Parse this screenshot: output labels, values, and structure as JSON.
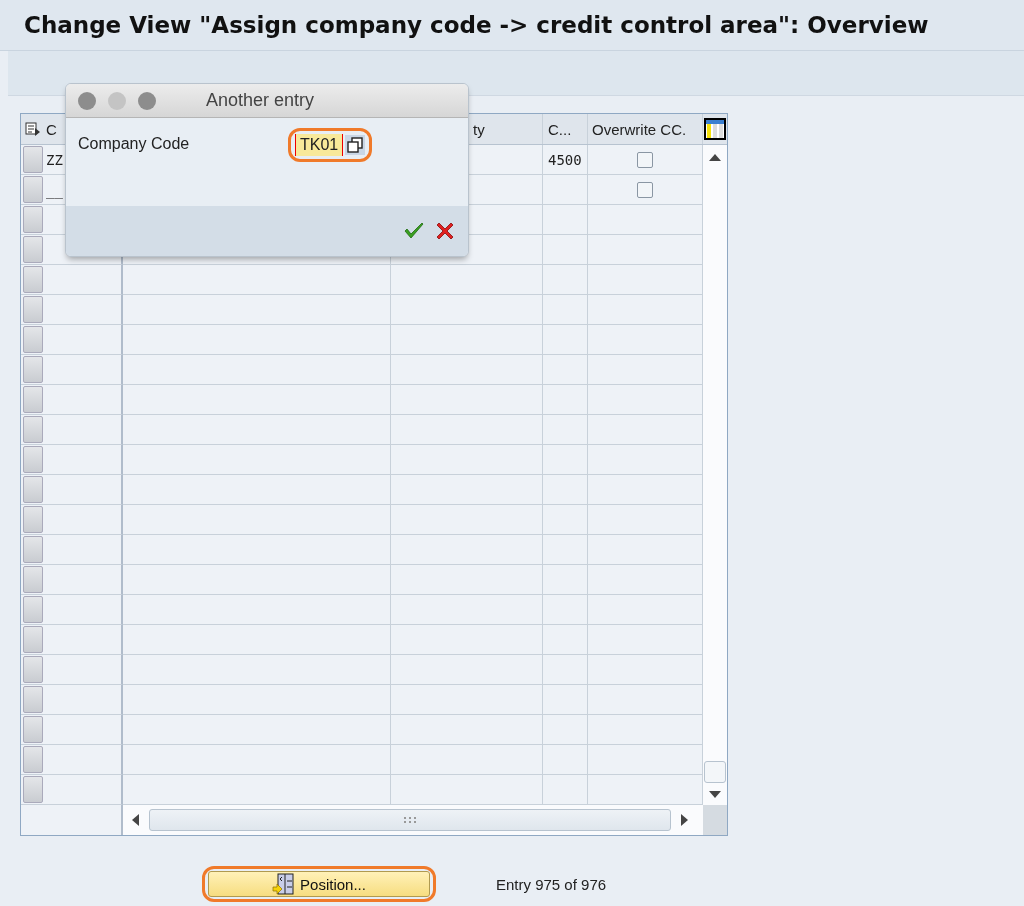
{
  "window": {
    "title": "Change View \"Assign company code -> credit control area\": Overview"
  },
  "table": {
    "headers": {
      "column_1": "C",
      "column_3": "ty",
      "column_4": "C...",
      "column_5": "Overwrite CC."
    },
    "rows": [
      {
        "column_1": "ZZ",
        "column_4": "4500",
        "overwrite": {
          "checked": false
        }
      },
      {
        "column_1": "__",
        "overwrite": {
          "checked": false
        }
      }
    ]
  },
  "dialog": {
    "title": "Another entry",
    "field_label": "Company Code",
    "field_value": "TK01"
  },
  "footer": {
    "button": "Position...",
    "entry_info": "Entry 975 of 976"
  }
}
